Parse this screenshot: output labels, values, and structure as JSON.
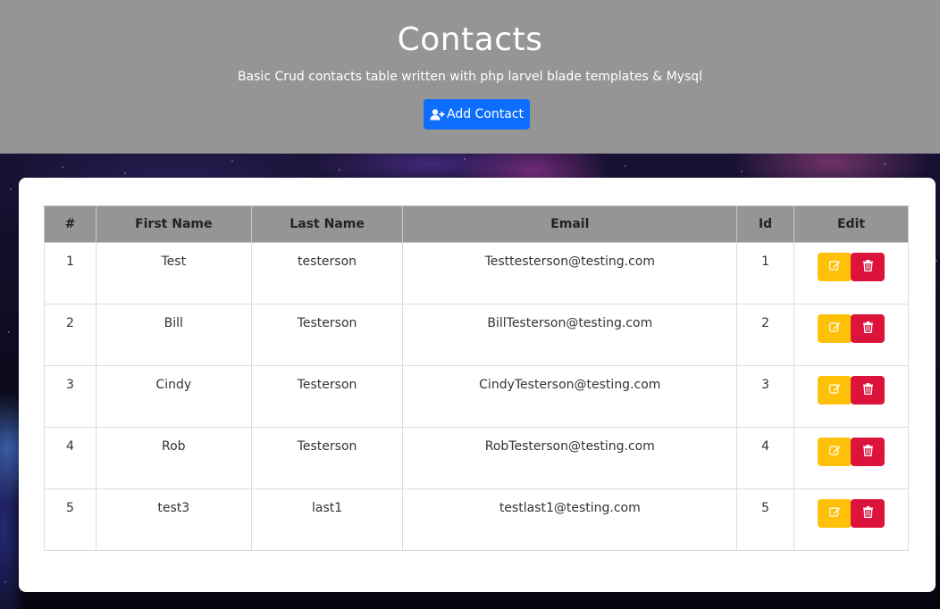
{
  "header": {
    "title": "Contacts",
    "subtitle": "Basic Crud contacts table written with php larvel blade templates & Mysql",
    "add_button_label": "Add Contact"
  },
  "table": {
    "columns": [
      "#",
      "First Name",
      "Last Name",
      "Email",
      "Id",
      "Edit"
    ],
    "rows": [
      {
        "num": "1",
        "first": "Test",
        "last": "testerson",
        "email": "Testtesterson@testing.com",
        "id": "1"
      },
      {
        "num": "2",
        "first": "Bill",
        "last": "Testerson",
        "email": "BillTesterson@testing.com",
        "id": "2"
      },
      {
        "num": "3",
        "first": "Cindy",
        "last": "Testerson",
        "email": "CindyTesterson@testing.com",
        "id": "3"
      },
      {
        "num": "4",
        "first": "Rob",
        "last": "Testerson",
        "email": "RobTesterson@testing.com",
        "id": "4"
      },
      {
        "num": "5",
        "first": "test3",
        "last": "last1",
        "email": "testlast1@testing.com",
        "id": "5"
      }
    ]
  },
  "icons": {
    "add": "user-plus-icon",
    "edit": "edit-icon",
    "delete": "trash-icon"
  },
  "colors": {
    "header_bg": "#959595",
    "primary": "#0d6efd",
    "warning": "#ffc107",
    "danger": "#dc143c"
  }
}
